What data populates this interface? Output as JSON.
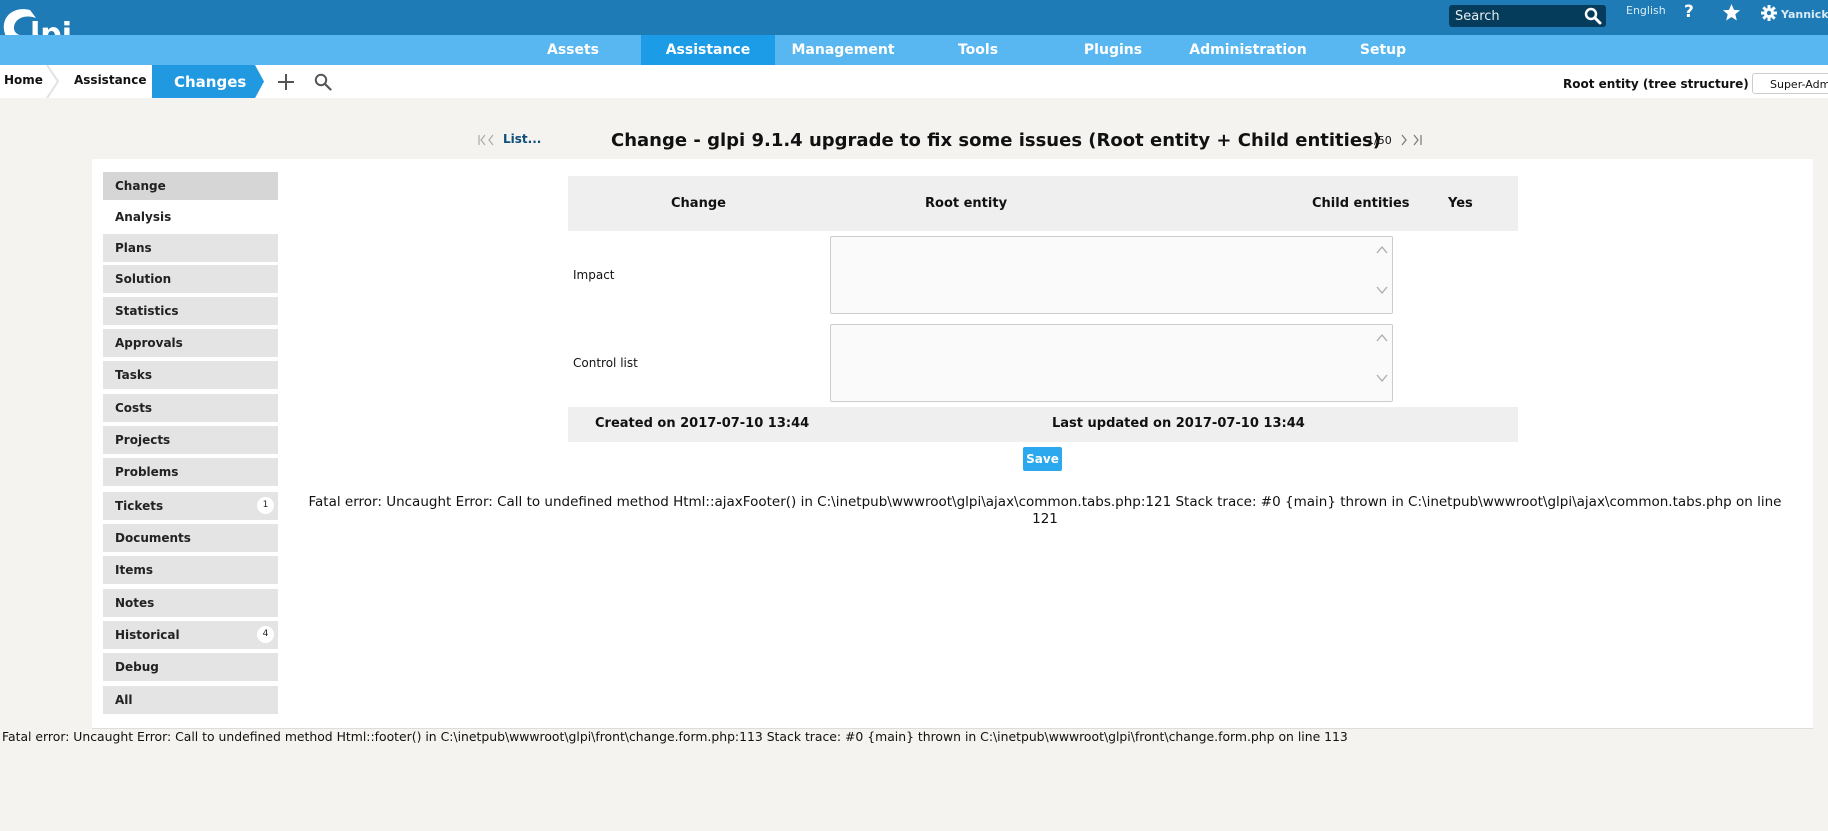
{
  "header": {
    "logo_text": "Glpi",
    "search_placeholder": "Search",
    "language": "English",
    "help_label": "?",
    "user_name": "Yannick"
  },
  "menu": [
    "Assets",
    "Assistance",
    "Management",
    "Tools",
    "Plugins",
    "Administration",
    "Setup"
  ],
  "menu_active": "Assistance",
  "breadcrumb": {
    "home": "Home",
    "section": "Assistance",
    "current": "Changes"
  },
  "entity": {
    "label": "Root entity (tree structure)",
    "profile": "Super-Admin"
  },
  "navigation": {
    "list_label": "List...",
    "title": "Change - glpi 9.1.4 upgrade to fix some issues (Root entity + Child entities)",
    "count": "1/50"
  },
  "tabs": [
    {
      "label": "Change"
    },
    {
      "label": "Analysis"
    },
    {
      "label": "Plans"
    },
    {
      "label": "Solution"
    },
    {
      "label": "Statistics"
    },
    {
      "label": "Approvals"
    },
    {
      "label": "Tasks"
    },
    {
      "label": "Costs"
    },
    {
      "label": "Projects"
    },
    {
      "label": "Problems"
    },
    {
      "label": "Tickets",
      "badge": "1"
    },
    {
      "label": "Documents"
    },
    {
      "label": "Items"
    },
    {
      "label": "Notes"
    },
    {
      "label": "Historical",
      "badge": "4"
    },
    {
      "label": "Debug"
    },
    {
      "label": "All"
    }
  ],
  "active_tab": "Analysis",
  "form": {
    "header": {
      "type": "Change",
      "entity": "Root entity",
      "child_label": "Child entities",
      "child_value": "Yes"
    },
    "fields": [
      {
        "label": "Impact",
        "value": ""
      },
      {
        "label": "Control list",
        "value": ""
      }
    ],
    "created": "Created on 2017-07-10 13:44",
    "updated": "Last updated on 2017-07-10 13:44",
    "save_label": "Save"
  },
  "errors": {
    "ajax": "Fatal error: Uncaught Error: Call to undefined method Html::ajaxFooter() in C:\\inetpub\\wwwroot\\glpi\\ajax\\common.tabs.php:121 Stack trace: #0 {main} thrown in C:\\inetpub\\wwwroot\\glpi\\ajax\\common.tabs.php on line 121",
    "page": "Fatal error: Uncaught Error: Call to undefined method Html::footer() in C:\\inetpub\\wwwroot\\glpi\\front\\change.form.php:113 Stack trace: #0 {main} thrown in C:\\inetpub\\wwwroot\\glpi\\front\\change.form.php on line 113"
  },
  "colors": {
    "topbar": "#1e7bb5",
    "menubar": "#58b6f0",
    "accent": "#2199e0",
    "button": "#2ca8ee"
  }
}
